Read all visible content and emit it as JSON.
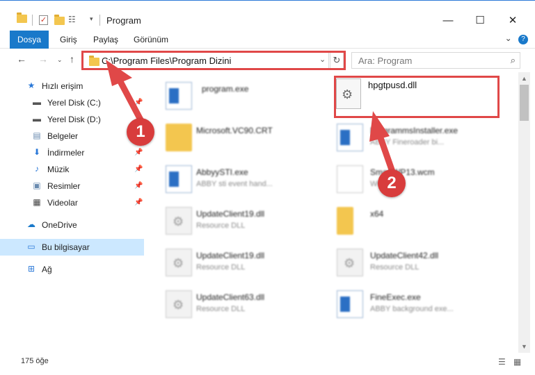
{
  "window": {
    "title": "Program",
    "minimize": "—",
    "maximize": "☐",
    "close": "✕"
  },
  "ribbon": {
    "tabs": [
      "Dosya",
      "Giriş",
      "Paylaş",
      "Görünüm"
    ],
    "expand_icon": "chevron-down",
    "help_icon": "question-icon"
  },
  "address": {
    "path": "C:\\Program Files\\Program Dizini",
    "search_placeholder": "Ara: Program"
  },
  "sidebar": {
    "items": [
      {
        "label": "Hızlı erişim",
        "icon": "star-icon"
      },
      {
        "label": "Yerel Disk (C:)",
        "icon": "drive-icon",
        "pinned": true
      },
      {
        "label": "Yerel Disk (D:)",
        "icon": "drive-icon"
      },
      {
        "label": "Belgeler",
        "icon": "documents-icon"
      },
      {
        "label": "İndirmeler",
        "icon": "download-icon",
        "pinned": true
      },
      {
        "label": "Müzik",
        "icon": "music-icon",
        "pinned": true
      },
      {
        "label": "Resimler",
        "icon": "pictures-icon",
        "pinned": true
      },
      {
        "label": "Videolar",
        "icon": "video-icon",
        "pinned": true
      },
      {
        "label": "OneDrive",
        "icon": "cloud-icon"
      },
      {
        "label": "Bu bilgisayar",
        "icon": "computer-icon",
        "selected": true
      },
      {
        "label": "Ağ",
        "icon": "network-icon"
      }
    ]
  },
  "files": [
    {
      "name": "program.exe",
      "desc": "",
      "type": "exe"
    },
    {
      "name": "hpgtpusd.dll",
      "desc": "",
      "type": "dll",
      "highlighted": true
    },
    {
      "name": "Microsoft.VC90.CRT",
      "desc": "",
      "type": "folder"
    },
    {
      "name": "ProgrammsInstaller.exe",
      "desc": "ABBY Fineroader bi...",
      "type": "exe"
    },
    {
      "name": "AbbyySTI.exe",
      "desc": "ABBY sti event hand...",
      "type": "exe"
    },
    {
      "name": "SmartWP13.wcm",
      "desc": "WCM",
      "type": "doc"
    },
    {
      "name": "UpdateClient19.dll",
      "desc": "Resource DLL",
      "type": "dll"
    },
    {
      "name": "x64",
      "desc": "",
      "type": "folder"
    },
    {
      "name": "UpdateClient19.dll",
      "desc": "Resource DLL",
      "type": "dll"
    },
    {
      "name": "UpdateClient42.dll",
      "desc": "Resource DLL",
      "type": "dll"
    },
    {
      "name": "UpdateClient63.dll",
      "desc": "Resource DLL",
      "type": "dll"
    },
    {
      "name": "FineExec.exe",
      "desc": "ABBY background exe...",
      "type": "exe"
    }
  ],
  "status": {
    "count": "175 öğe"
  },
  "annotations": {
    "badge1": "1",
    "badge2": "2",
    "color": "#e04848"
  }
}
